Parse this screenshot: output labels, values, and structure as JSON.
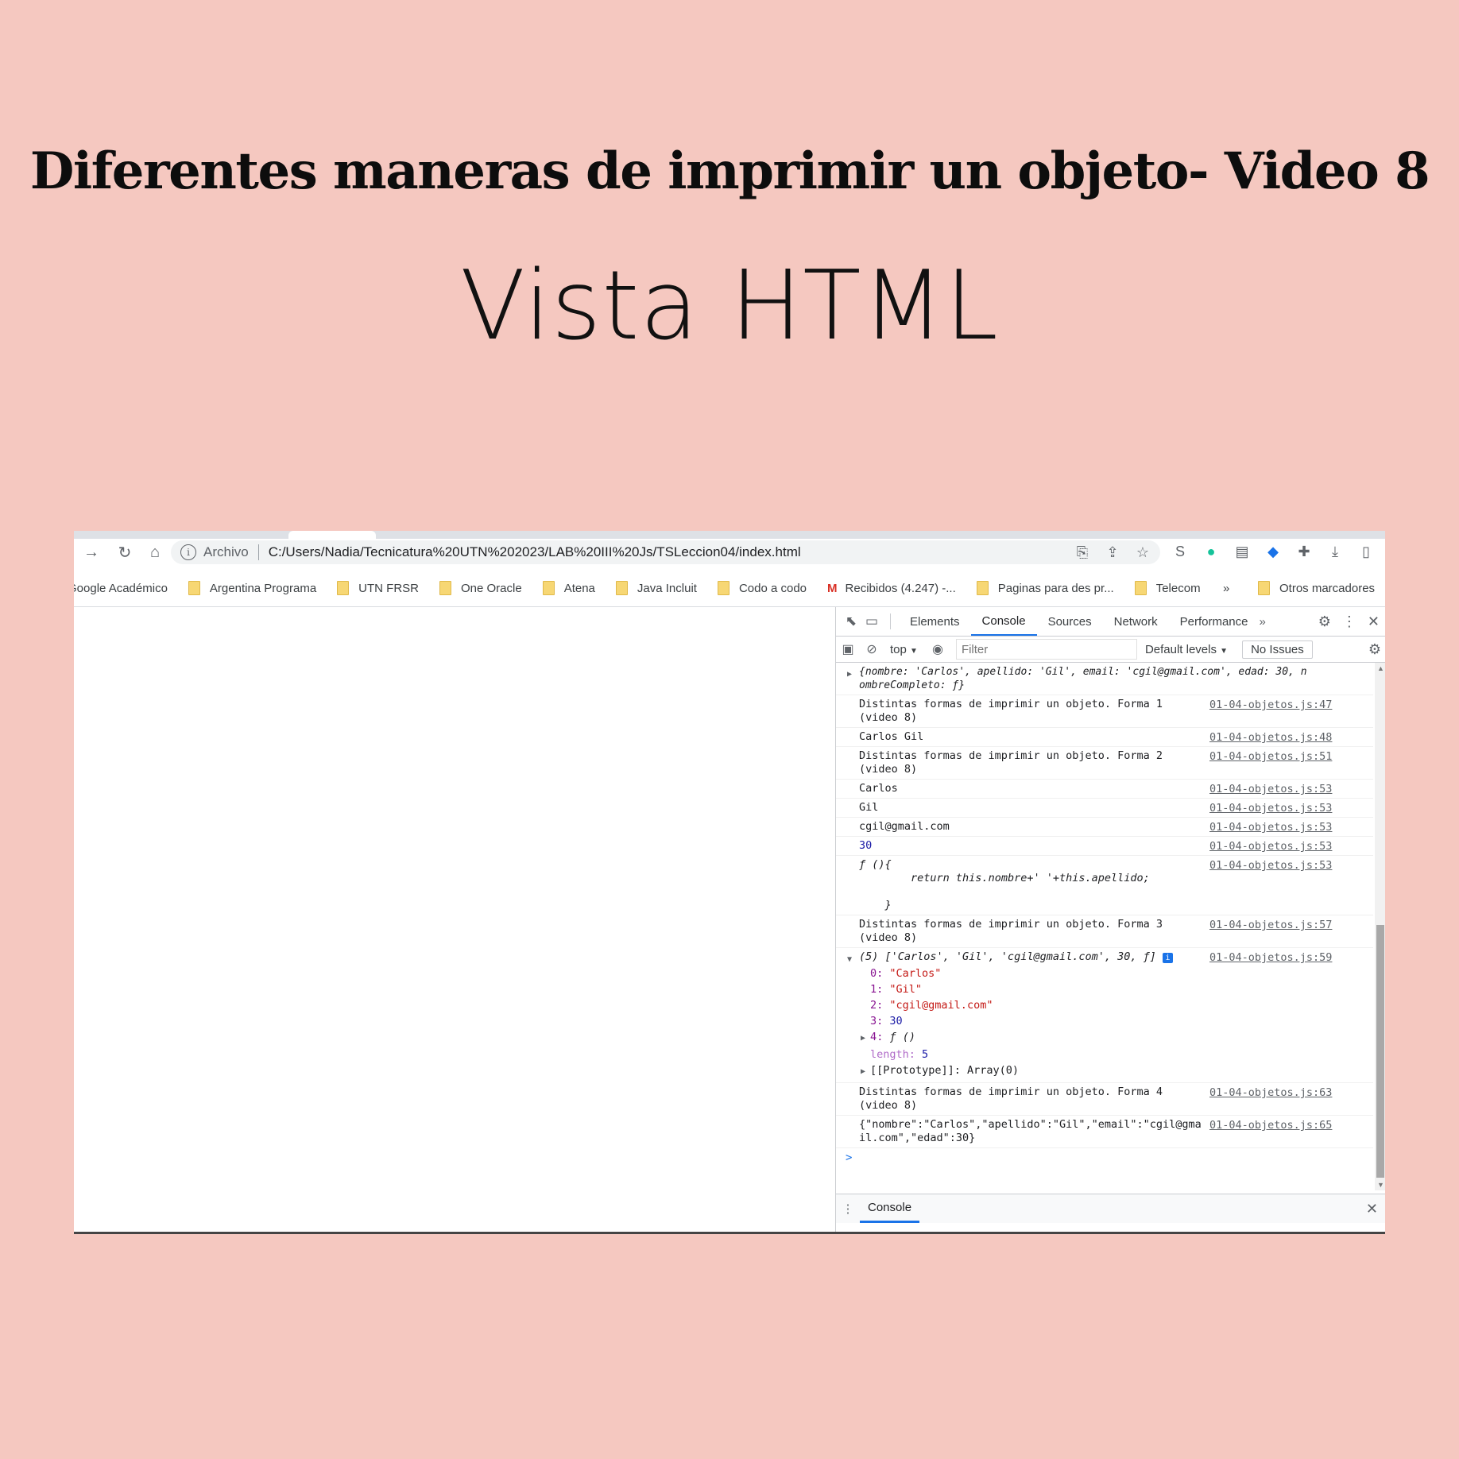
{
  "headline": "Diferentes maneras de imprimir un objeto- Video 8",
  "subhead": "Vista HTML",
  "browser": {
    "omnibox": {
      "scheme_label": "Archivo",
      "url": "C:/Users/Nadia/Tecnicatura%20UTN%202023/LAB%20III%20Js/TSLeccion04/index.html"
    },
    "bookmarks": [
      "Google Académico",
      "Argentina Programa",
      "UTN FRSR",
      "One Oracle",
      "Atena",
      "Java Incluit",
      "Codo a codo",
      "Recibidos (4.247) -...",
      "Paginas para des pr...",
      "Telecom"
    ],
    "bookmarks_more": "»",
    "other_bookmarks": "Otros marcadores"
  },
  "devtools": {
    "tabs": [
      "Elements",
      "Console",
      "Sources",
      "Network",
      "Performance"
    ],
    "active_tab": "Console",
    "more_tabs": "»",
    "context": "top",
    "filter_placeholder": "Filter",
    "levels": "Default levels",
    "issues": "No Issues",
    "drawer_tab": "Console",
    "console": {
      "obj_line_1": "{nombre: 'Carlos', apellido: 'Gil', email: 'cgil@gmail.com', edad: 30, n",
      "obj_line_2": "ombreCompleto: ƒ}",
      "forma1": "Distintas formas de imprimir un objeto. Forma 1\n(video 8)",
      "forma1_src": "01-04-objetos.js:47",
      "carlos_gil": "Carlos Gil",
      "carlos_gil_src": "01-04-objetos.js:48",
      "forma2": "Distintas formas de imprimir un objeto. Forma 2\n(video 8)",
      "forma2_src": "01-04-objetos.js:51",
      "v_carlos": "Carlos",
      "v_gil": "Gil",
      "v_email": "cgil@gmail.com",
      "v_edad": "30",
      "v_fn": "ƒ (){\n        return this.nombre+' '+this.apellido;\n\n    }",
      "src53": "01-04-objetos.js:53",
      "forma3": "Distintas formas de imprimir un objeto. Forma 3\n(video 8)",
      "forma3_src": "01-04-objetos.js:57",
      "arr_header": "(5) ['Carlos', 'Gil', 'cgil@gmail.com', 30, ƒ]",
      "arr_src": "01-04-objetos.js:59",
      "arr_items": [
        {
          "k": "0",
          "v": "\"Carlos\""
        },
        {
          "k": "1",
          "v": "\"Gil\""
        },
        {
          "k": "2",
          "v": "\"cgil@gmail.com\""
        },
        {
          "k": "3",
          "v": "30"
        },
        {
          "k": "4",
          "v": "ƒ ()"
        }
      ],
      "arr_length_key": "length",
      "arr_length_val": "5",
      "arr_proto": "[[Prototype]]: Array(0)",
      "forma4": "Distintas formas de imprimir un objeto. Forma 4\n(video 8)",
      "forma4_src": "01-04-objetos.js:63",
      "json_out": "{\"nombre\":\"Carlos\",\"apellido\":\"Gil\",\"email\":\"cgil@gma\nil.com\",\"edad\":30}",
      "json_src": "01-04-objetos.js:65",
      "prompt": ">"
    }
  }
}
